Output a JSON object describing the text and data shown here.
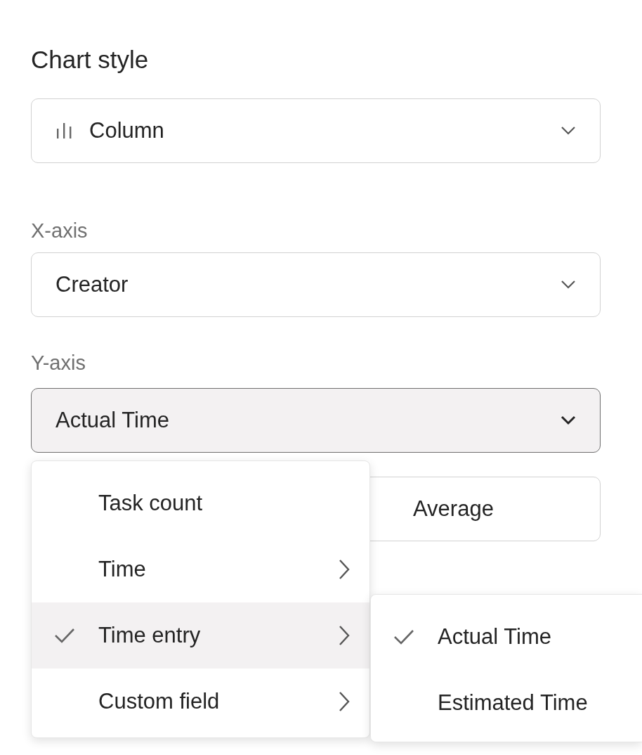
{
  "chart_style": {
    "label": "Chart style",
    "value": "Column"
  },
  "x_axis": {
    "label": "X-axis",
    "value": "Creator"
  },
  "y_axis": {
    "label": "Y-axis",
    "value": "Actual Time",
    "expanded": true
  },
  "aggregation": {
    "value": "Average"
  },
  "menu": {
    "items": [
      {
        "label": "Task count",
        "selected": false,
        "highlighted": false,
        "has_submenu": false
      },
      {
        "label": "Time",
        "selected": false,
        "highlighted": false,
        "has_submenu": true
      },
      {
        "label": "Time entry",
        "selected": true,
        "highlighted": true,
        "has_submenu": true
      },
      {
        "label": "Custom field",
        "selected": false,
        "highlighted": false,
        "has_submenu": true
      }
    ]
  },
  "submenu": {
    "items": [
      {
        "label": "Actual Time",
        "selected": true
      },
      {
        "label": "Estimated Time",
        "selected": false
      }
    ]
  }
}
